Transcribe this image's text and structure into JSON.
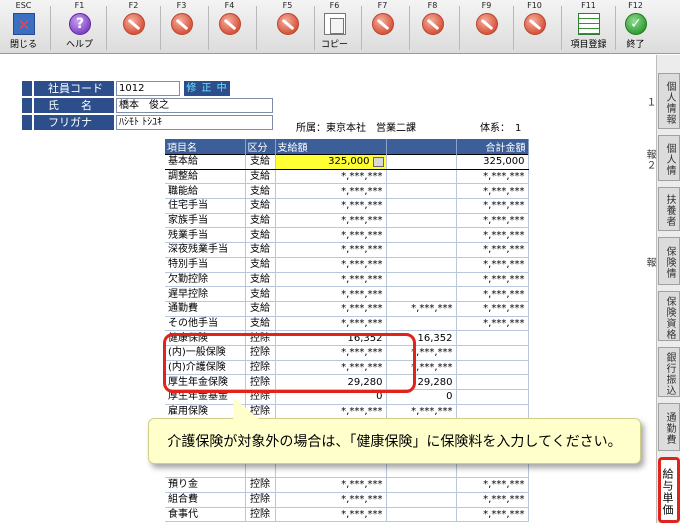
{
  "toolbar": {
    "keys": [
      {
        "key": "ESC",
        "label": "閉じる",
        "icon": "close-icon"
      },
      {
        "key": "F1",
        "label": "ヘルプ",
        "icon": "help-icon"
      },
      {
        "key": "F2",
        "label": "",
        "icon": "disabled-icon"
      },
      {
        "key": "F3",
        "label": "",
        "icon": "disabled-icon"
      },
      {
        "key": "F4",
        "label": "",
        "icon": "disabled-icon"
      },
      {
        "key": "F5",
        "label": "",
        "icon": "disabled-icon"
      },
      {
        "key": "F6",
        "label": "コピー",
        "icon": "copy-icon"
      },
      {
        "key": "F7",
        "label": "",
        "icon": "disabled-icon"
      },
      {
        "key": "F8",
        "label": "",
        "icon": "disabled-icon"
      },
      {
        "key": "F9",
        "label": "",
        "icon": "disabled-icon"
      },
      {
        "key": "F10",
        "label": "",
        "icon": "disabled-icon"
      },
      {
        "key": "F11",
        "label": "項目登録",
        "icon": "grid-icon"
      },
      {
        "key": "F12",
        "label": "終了",
        "icon": "check-icon"
      }
    ]
  },
  "employee": {
    "code_label": "社員コード",
    "code": "1012",
    "status": "修 正 中",
    "name_label": "氏　　名",
    "name": "橋本　俊之",
    "kana_label": "フリガナ",
    "kana": "ﾊｼﾓﾄ ﾄｼﾕｷ",
    "affiliation": "所属：東京本社　営業二課",
    "system": "体系：　1"
  },
  "grid": {
    "headers": [
      "項目名",
      "区分",
      "支給額",
      "",
      "合計金額"
    ],
    "rows": [
      {
        "name": "基本給",
        "kbn": "支給",
        "amount": "325,000",
        "extra": "",
        "total": "325,000"
      },
      {
        "name": "調整給",
        "kbn": "支給",
        "amount": "*,***,***",
        "extra": "",
        "total": "*,***,***"
      },
      {
        "name": "職能給",
        "kbn": "支給",
        "amount": "*,***,***",
        "extra": "",
        "total": "*,***,***"
      },
      {
        "name": "住宅手当",
        "kbn": "支給",
        "amount": "*,***,***",
        "extra": "",
        "total": "*,***,***"
      },
      {
        "name": "家族手当",
        "kbn": "支給",
        "amount": "*,***,***",
        "extra": "",
        "total": "*,***,***"
      },
      {
        "name": "残業手当",
        "kbn": "支給",
        "amount": "*,***,***",
        "extra": "",
        "total": "*,***,***"
      },
      {
        "name": "深夜残業手当",
        "kbn": "支給",
        "amount": "*,***,***",
        "extra": "",
        "total": "*,***,***"
      },
      {
        "name": "特別手当",
        "kbn": "支給",
        "amount": "*,***,***",
        "extra": "",
        "total": "*,***,***"
      },
      {
        "name": "欠勤控除",
        "kbn": "支給",
        "amount": "*,***,***",
        "extra": "",
        "total": "*,***,***"
      },
      {
        "name": "遅早控除",
        "kbn": "支給",
        "amount": "*,***,***",
        "extra": "",
        "total": "*,***,***"
      },
      {
        "name": "通勤費",
        "kbn": "支給",
        "amount": "*,***,***",
        "extra": "*,***,***",
        "total": "*,***,***"
      },
      {
        "name": "その他手当",
        "kbn": "支給",
        "amount": "*,***,***",
        "extra": "",
        "total": "*,***,***"
      },
      {
        "name": "健康保険",
        "kbn": "控除",
        "amount": "16,352",
        "extra": "16,352",
        "total": ""
      },
      {
        "name": "(内)一般保険",
        "kbn": "控除",
        "amount": "*,***,***",
        "extra": "*,***,***",
        "total": ""
      },
      {
        "name": "(内)介護保険",
        "kbn": "控除",
        "amount": "*,***,***",
        "extra": "*,***,***",
        "total": ""
      },
      {
        "name": "厚生年金保険",
        "kbn": "控除",
        "amount": "29,280",
        "extra": "29,280",
        "total": ""
      },
      {
        "name": "厚生年金基金",
        "kbn": "控除",
        "amount": "0",
        "extra": "0",
        "total": ""
      },
      {
        "name": "雇用保険",
        "kbn": "控除",
        "amount": "*,***,***",
        "extra": "*,***,***",
        "total": ""
      },
      {
        "name": "",
        "kbn": "",
        "amount": "",
        "extra": "",
        "total": ""
      },
      {
        "name": "",
        "kbn": "",
        "amount": "",
        "extra": "",
        "total": ""
      },
      {
        "name": "",
        "kbn": "",
        "amount": "",
        "extra": "",
        "total": ""
      },
      {
        "name": "",
        "kbn": "",
        "amount": "",
        "extra": "",
        "total": ""
      },
      {
        "name": "預り金",
        "kbn": "控除",
        "amount": "*,***,***",
        "extra": "",
        "total": "*,***,***"
      },
      {
        "name": "組合費",
        "kbn": "控除",
        "amount": "*,***,***",
        "extra": "",
        "total": "*,***,***"
      },
      {
        "name": "食事代",
        "kbn": "控除",
        "amount": "*,***,***",
        "extra": "",
        "total": "*,***,***"
      }
    ]
  },
  "tooltip": "介護保険が対象外の場合は、「健康保険」に保険料を入力してください。",
  "side_tabs": [
    "個人情報１",
    "個人情報２",
    "扶養者",
    "保険情報",
    "保険資格",
    "銀行振込",
    "通勤費",
    "給与単価"
  ],
  "colors": {
    "header_bg": "#3c5e99",
    "label_bg": "#2c4f8c",
    "highlight": "#e0241c",
    "input_bg": "#ffff33"
  }
}
